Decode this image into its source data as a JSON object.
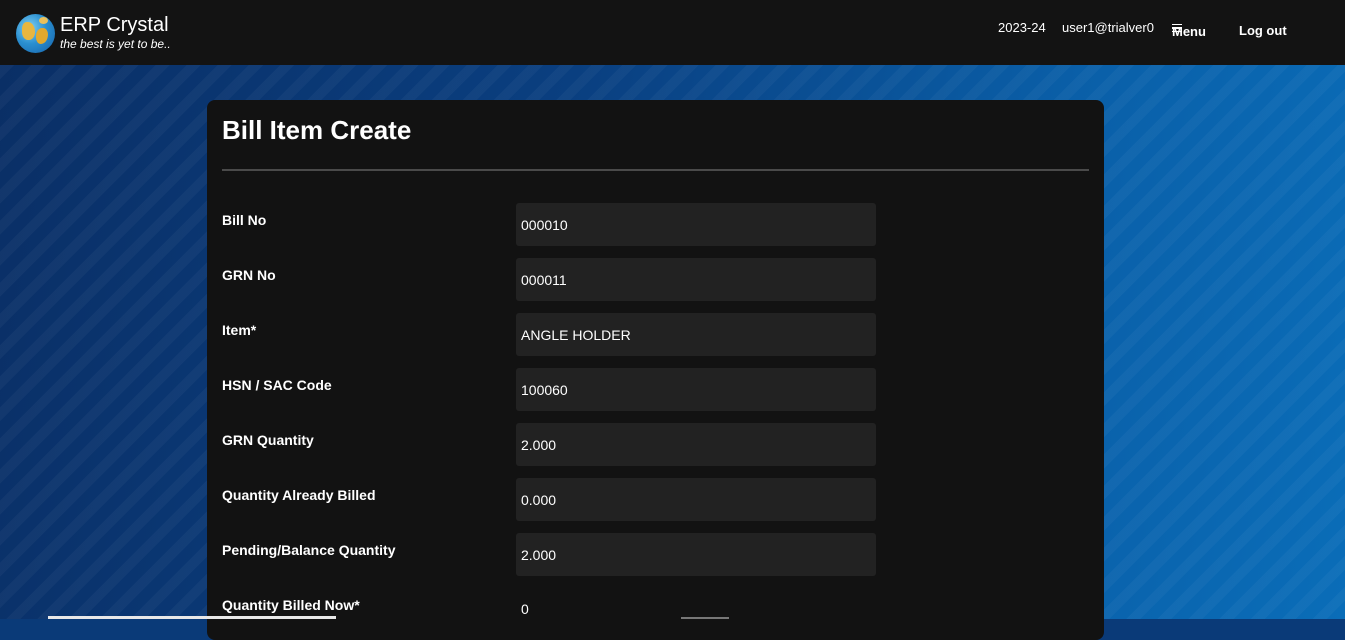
{
  "brand": {
    "name": "ERP Crystal",
    "tagline": "the best is yet to be.."
  },
  "nav": {
    "year": "2023-24",
    "user": "user1@trialver0",
    "menu_label": "Menu",
    "logout_label": "Log out"
  },
  "page": {
    "title": "Bill Item Create"
  },
  "form": {
    "fields": [
      {
        "label": "Bill No",
        "value": "000010"
      },
      {
        "label": "GRN No",
        "value": "000011"
      },
      {
        "label": "Item*",
        "value": "ANGLE HOLDER"
      },
      {
        "label": "HSN / SAC Code",
        "value": "100060"
      },
      {
        "label": "GRN Quantity",
        "value": "2.000"
      },
      {
        "label": "Quantity Already Billed",
        "value": "0.000"
      },
      {
        "label": "Pending/Balance Quantity",
        "value": "2.000"
      },
      {
        "label": "Quantity Billed Now*",
        "value": "0"
      }
    ]
  },
  "colors": {
    "navbar": "#131313",
    "card": "#121212",
    "input_bg": "#222222",
    "background_accent": "#0a5fa8"
  }
}
